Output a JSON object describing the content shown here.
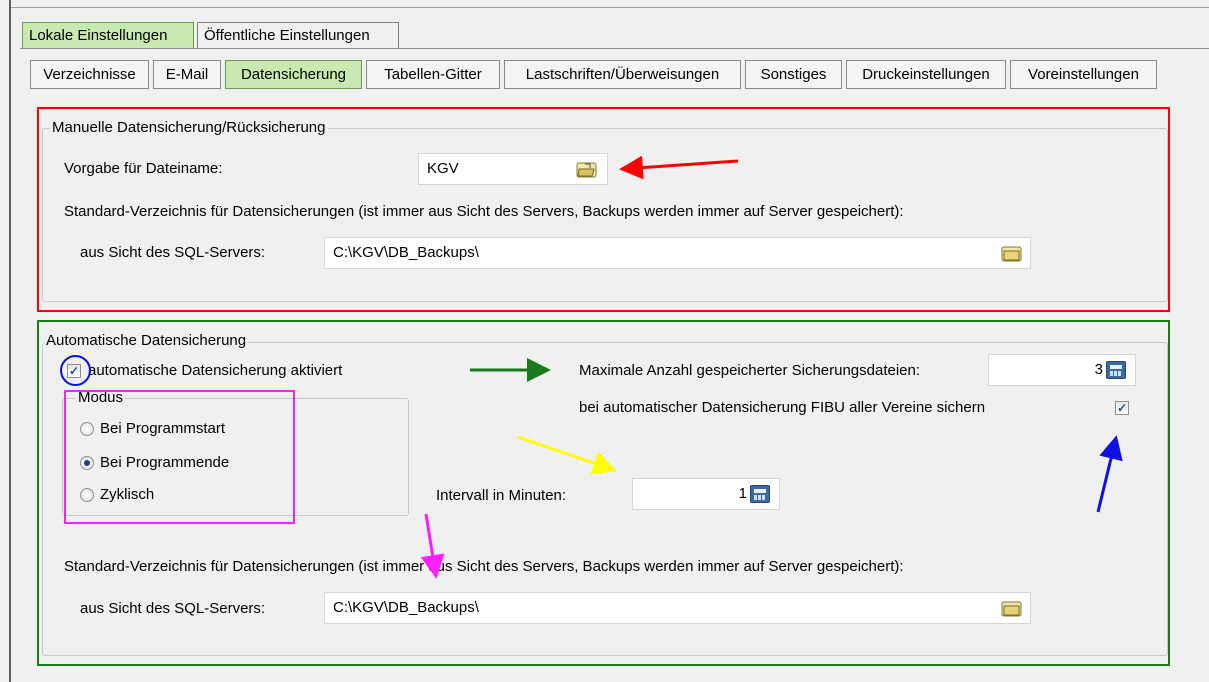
{
  "top_tabs": [
    {
      "label": "Lokale Einstellungen",
      "active": true
    },
    {
      "label": "Öffentliche Einstellungen",
      "active": false
    }
  ],
  "sub_tabs": [
    {
      "label": "Verzeichnisse",
      "active": false
    },
    {
      "label": "E-Mail",
      "active": false
    },
    {
      "label": "Datensicherung",
      "active": true
    },
    {
      "label": "Tabellen-Gitter",
      "active": false
    },
    {
      "label": "Lastschriften/Überweisungen",
      "active": false
    },
    {
      "label": "Sonstiges",
      "active": false
    },
    {
      "label": "Druckeinstellungen",
      "active": false
    },
    {
      "label": "Voreinstellungen",
      "active": false
    }
  ],
  "manual": {
    "legend": "Manuelle Datensicherung/Rücksicherung",
    "filename_label": "Vorgabe für Dateiname:",
    "filename_value": "KGV",
    "dir_description": "Standard-Verzeichnis für Datensicherungen (ist immer aus Sicht des Servers, Backups werden immer auf Server gespeichert):",
    "server_label": "aus Sicht des SQL-Servers:",
    "server_path": "C:\\KGV\\DB_Backups\\"
  },
  "auto": {
    "legend": "Automatische Datensicherung",
    "enabled_label": "automatische Datensicherung aktiviert",
    "enabled": true,
    "max_files_label": "Maximale Anzahl gespeicherter Sicherungsdateien:",
    "max_files_value": "3",
    "fibu_label": "bei automatischer Datensicherung FIBU aller Vereine sichern",
    "fibu_checked": true,
    "modus": {
      "legend": "Modus",
      "options": [
        {
          "label": "Bei Programmstart",
          "checked": false
        },
        {
          "label": "Bei Programmende",
          "checked": true
        },
        {
          "label": "Zyklisch",
          "checked": false
        }
      ]
    },
    "interval_label": "Intervall in Minuten:",
    "interval_value": "1",
    "dir_description": "Standard-Verzeichnis für Datensicherungen (ist immer aus Sicht des Servers, Backups werden immer auf Server gespeichert):",
    "server_label": "aus Sicht des SQL-Servers:",
    "server_path": "C:\\KGV\\DB_Backups\\"
  },
  "annotation_colors": {
    "red": "#ff0000",
    "green": "#1a7a1a",
    "blue": "#1010e0",
    "magenta": "#ff20ff",
    "yellow": "#ffff00"
  }
}
